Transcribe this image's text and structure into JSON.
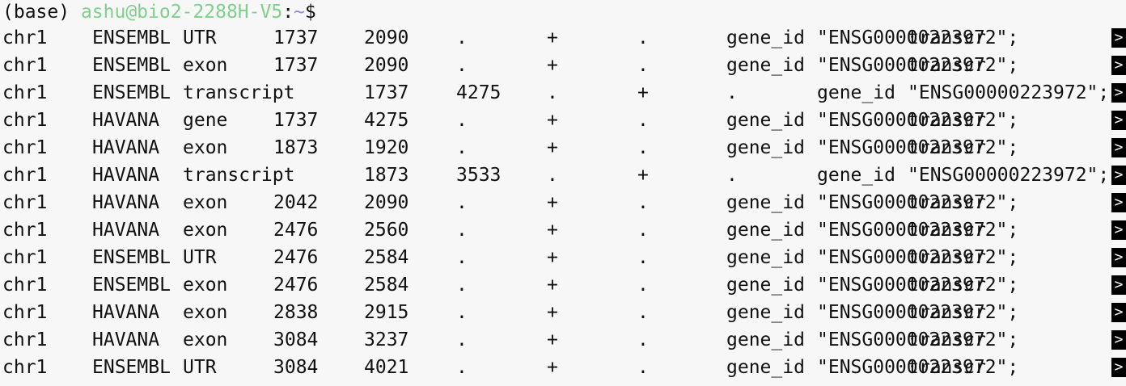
{
  "prompt": {
    "env": "(base) ",
    "user_host": "ashu@bio2-2288H-V5",
    "sep": ":",
    "path": "~",
    "symbol": "$"
  },
  "overflow_marker": ">",
  "rows": [
    {
      "cols": [
        "chr1",
        "ENSEMBL",
        "UTR",
        "1737",
        "2090",
        ".",
        "+",
        ".",
        "gene_id",
        "\"ENSG00000223972\";",
        "transcr"
      ],
      "layout": "normal"
    },
    {
      "cols": [
        "chr1",
        "ENSEMBL",
        "exon",
        "1737",
        "2090",
        ".",
        "+",
        ".",
        "gene_id",
        "\"ENSG00000223972\";",
        "transcr"
      ],
      "layout": "normal"
    },
    {
      "cols": [
        "chr1",
        "ENSEMBL",
        "transcript",
        "1737",
        "4275",
        ".",
        "+",
        ".",
        "gene_id",
        "\"ENSG00000223972\";",
        ""
      ],
      "layout": "shifted"
    },
    {
      "cols": [
        "chr1",
        "HAVANA",
        "gene",
        "1737",
        "4275",
        ".",
        "+",
        ".",
        "gene_id",
        "\"ENSG00000223972\";",
        "transcr"
      ],
      "layout": "normal"
    },
    {
      "cols": [
        "chr1",
        "HAVANA",
        "exon",
        "1873",
        "1920",
        ".",
        "+",
        ".",
        "gene_id",
        "\"ENSG00000223972\";",
        "transcr"
      ],
      "layout": "normal"
    },
    {
      "cols": [
        "chr1",
        "HAVANA",
        "transcript",
        "1873",
        "3533",
        ".",
        "+",
        ".",
        "gene_id",
        "\"ENSG00000223972\";",
        ""
      ],
      "layout": "shifted"
    },
    {
      "cols": [
        "chr1",
        "HAVANA",
        "exon",
        "2042",
        "2090",
        ".",
        "+",
        ".",
        "gene_id",
        "\"ENSG00000223972\";",
        "transcr"
      ],
      "layout": "normal"
    },
    {
      "cols": [
        "chr1",
        "HAVANA",
        "exon",
        "2476",
        "2560",
        ".",
        "+",
        ".",
        "gene_id",
        "\"ENSG00000223972\";",
        "transcr"
      ],
      "layout": "normal"
    },
    {
      "cols": [
        "chr1",
        "ENSEMBL",
        "UTR",
        "2476",
        "2584",
        ".",
        "+",
        ".",
        "gene_id",
        "\"ENSG00000223972\";",
        "transcr"
      ],
      "layout": "normal"
    },
    {
      "cols": [
        "chr1",
        "ENSEMBL",
        "exon",
        "2476",
        "2584",
        ".",
        "+",
        ".",
        "gene_id",
        "\"ENSG00000223972\";",
        "transcr"
      ],
      "layout": "normal"
    },
    {
      "cols": [
        "chr1",
        "HAVANA",
        "exon",
        "2838",
        "2915",
        ".",
        "+",
        ".",
        "gene_id",
        "\"ENSG00000223972\";",
        "transcr"
      ],
      "layout": "normal"
    },
    {
      "cols": [
        "chr1",
        "HAVANA",
        "exon",
        "3084",
        "3237",
        ".",
        "+",
        ".",
        "gene_id",
        "\"ENSG00000223972\";",
        "transcr"
      ],
      "layout": "normal"
    },
    {
      "cols": [
        "chr1",
        "ENSEMBL",
        "UTR",
        "3084",
        "4021",
        ".",
        "+",
        ".",
        "gene_id",
        "\"ENSG00000223972\";",
        "transcr"
      ],
      "layout": "normal"
    }
  ]
}
